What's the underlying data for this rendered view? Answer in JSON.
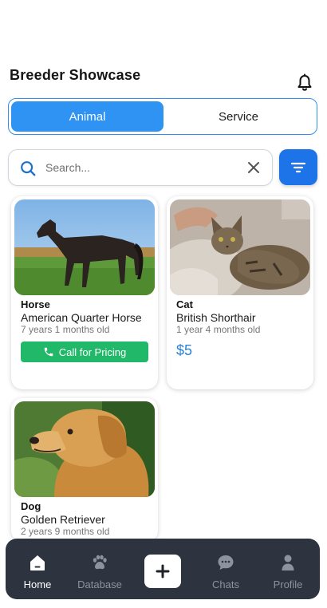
{
  "header": {
    "title": "Breeder Showcase",
    "bell_icon": "bell-icon"
  },
  "segment": {
    "options": [
      {
        "label": "Animal",
        "selected": true
      },
      {
        "label": "Service",
        "selected": false
      }
    ]
  },
  "search": {
    "placeholder": "Search...",
    "value": ""
  },
  "colors": {
    "accent": "#2f93f3",
    "filter_button": "#1d73e8",
    "call_button": "#22b86a",
    "price": "#2a83d4",
    "nav_background": "#2d3440"
  },
  "listings": [
    {
      "type": "Horse",
      "breed": "American Quarter Horse",
      "age": "7 years 1 months old",
      "action_label": "Call for Pricing",
      "price": null
    },
    {
      "type": "Cat",
      "breed": "British Shorthair",
      "age": "1 year 4 months old",
      "action_label": null,
      "price": "$5"
    },
    {
      "type": "Dog",
      "breed": "Golden Retriever",
      "age": "2 years 9 months old",
      "action_label": null,
      "price": null
    }
  ],
  "bottom_nav": {
    "items": [
      {
        "label": "Home",
        "icon": "home-icon",
        "active": true
      },
      {
        "label": "Database",
        "icon": "paw-icon",
        "active": false
      },
      {
        "label": "",
        "icon": "plus-icon",
        "active": false
      },
      {
        "label": "Chats",
        "icon": "chat-bubble-icon",
        "active": false
      },
      {
        "label": "Profile",
        "icon": "person-icon",
        "active": false
      }
    ]
  }
}
